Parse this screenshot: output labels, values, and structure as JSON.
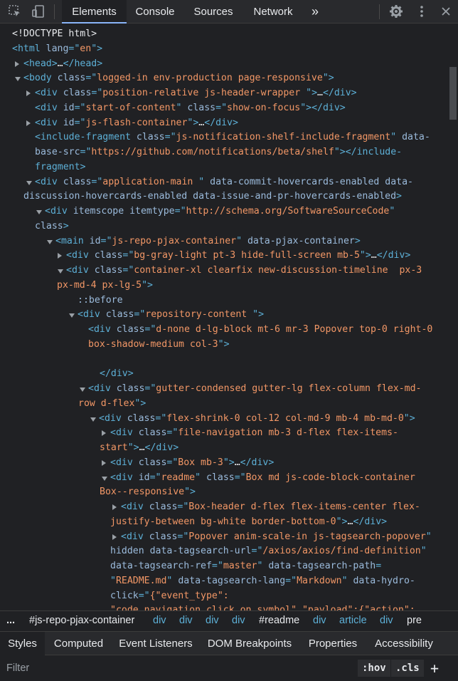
{
  "toolbar": {
    "tabs": [
      "Elements",
      "Console",
      "Sources",
      "Network"
    ],
    "more_tabs": "»",
    "icons": [
      "inspect-element-icon",
      "device-toolbar-icon",
      "settings-gear-icon",
      "more-vertical-icon",
      "close-icon"
    ]
  },
  "tree": [
    {
      "indent": 17,
      "arrow": "",
      "parts": [
        [
          "tx",
          "<!DOCTYPE html>"
        ]
      ]
    },
    {
      "indent": 17,
      "arrow": "",
      "parts": [
        [
          "tg",
          "<html "
        ],
        [
          "an",
          "lang"
        ],
        [
          "tg",
          "=\""
        ],
        [
          "av",
          "en"
        ],
        [
          "tg",
          "\">"
        ]
      ]
    },
    {
      "indent": 33,
      "arrow": "r",
      "parts": [
        [
          "tg",
          "<head>"
        ],
        [
          "tx",
          "…"
        ],
        [
          "tg",
          "</head>"
        ]
      ]
    },
    {
      "indent": 33,
      "arrow": "d",
      "parts": [
        [
          "tg",
          "<body "
        ],
        [
          "an",
          "class"
        ],
        [
          "tg",
          "=\""
        ],
        [
          "av",
          "logged-in env-production page-responsive"
        ],
        [
          "tg",
          "\">"
        ]
      ]
    },
    {
      "indent": 49,
      "arrow": "r",
      "parts": [
        [
          "tg",
          "<div "
        ],
        [
          "an",
          "class"
        ],
        [
          "tg",
          "=\""
        ],
        [
          "av",
          "position-relative js-header-wrapper "
        ],
        [
          "tg",
          "\">"
        ],
        [
          "tx",
          "…"
        ],
        [
          "tg",
          "</div>"
        ]
      ]
    },
    {
      "indent": 49,
      "arrow": "",
      "parts": [
        [
          "tg",
          "<div "
        ],
        [
          "an",
          "id"
        ],
        [
          "tg",
          "=\""
        ],
        [
          "av",
          "start-of-content"
        ],
        [
          "tg",
          "\" "
        ],
        [
          "an",
          "class"
        ],
        [
          "tg",
          "=\""
        ],
        [
          "av",
          "show-on-focus"
        ],
        [
          "tg",
          "\"></div>"
        ]
      ]
    },
    {
      "indent": 49,
      "arrow": "r",
      "parts": [
        [
          "tg",
          "<div "
        ],
        [
          "an",
          "id"
        ],
        [
          "tg",
          "=\""
        ],
        [
          "av",
          "js-flash-container"
        ],
        [
          "tg",
          "\">"
        ],
        [
          "tx",
          "…"
        ],
        [
          "tg",
          "</div>"
        ]
      ]
    },
    {
      "indent": 49,
      "arrow": "",
      "parts": [
        [
          "tg",
          "<include-fragment "
        ],
        [
          "an",
          "class"
        ],
        [
          "tg",
          "=\""
        ],
        [
          "av",
          "js-notification-shelf-include-fragment"
        ],
        [
          "tg",
          "\" "
        ],
        [
          "an",
          "data-"
        ]
      ]
    },
    {
      "indent": 49,
      "arrow": "",
      "parts": [
        [
          "an",
          "base-src"
        ],
        [
          "tg",
          "=\""
        ],
        [
          "av",
          "https://github.com/notifications/beta/shelf"
        ],
        [
          "tg",
          "\"></include-"
        ]
      ]
    },
    {
      "indent": 49,
      "arrow": "",
      "parts": [
        [
          "tg",
          "fragment>"
        ]
      ]
    },
    {
      "indent": 49,
      "arrow": "d",
      "parts": [
        [
          "tg",
          "<div "
        ],
        [
          "an",
          "class"
        ],
        [
          "tg",
          "=\""
        ],
        [
          "av",
          "application-main "
        ],
        [
          "tg",
          "\" "
        ],
        [
          "an",
          "data-commit-hovercards-enabled data-"
        ]
      ]
    },
    {
      "indent": 33,
      "arrow": "",
      "parts": [
        [
          "an",
          "discussion-hovercards-enabled data-issue-and-pr-hovercards-enabled"
        ],
        [
          "tg",
          ">"
        ]
      ]
    },
    {
      "indent": 63,
      "arrow": "d",
      "parts": [
        [
          "tg",
          "<div "
        ],
        [
          "an",
          "itemscope itemtype"
        ],
        [
          "tg",
          "=\""
        ],
        [
          "av",
          "http://schema.org/SoftwareSourceCode"
        ],
        [
          "tg",
          "\""
        ]
      ]
    },
    {
      "indent": 49,
      "arrow": "",
      "parts": [
        [
          "an",
          "class"
        ],
        [
          "tg",
          ">"
        ]
      ]
    },
    {
      "indent": 78,
      "arrow": "d",
      "parts": [
        [
          "tg",
          "<main "
        ],
        [
          "an",
          "id"
        ],
        [
          "tg",
          "=\""
        ],
        [
          "av",
          "js-repo-pjax-container"
        ],
        [
          "tg",
          "\" "
        ],
        [
          "an",
          "data-pjax-container"
        ],
        [
          "tg",
          ">"
        ]
      ]
    },
    {
      "indent": 93,
      "arrow": "r",
      "parts": [
        [
          "tg",
          "<div "
        ],
        [
          "an",
          "class"
        ],
        [
          "tg",
          "=\""
        ],
        [
          "av",
          "bg-gray-light pt-3 hide-full-screen mb-5"
        ],
        [
          "tg",
          "\">"
        ],
        [
          "tx",
          "…"
        ],
        [
          "tg",
          "</div>"
        ]
      ]
    },
    {
      "indent": 93,
      "arrow": "d",
      "parts": [
        [
          "tg",
          "<div "
        ],
        [
          "an",
          "class"
        ],
        [
          "tg",
          "=\""
        ],
        [
          "av",
          "container-xl clearfix new-discussion-timeline  px-3"
        ]
      ]
    },
    {
      "indent": 80,
      "arrow": "",
      "parts": [
        [
          "av",
          "px-md-4 px-lg-5"
        ],
        [
          "tg",
          "\">"
        ]
      ]
    },
    {
      "indent": 109,
      "arrow": "",
      "parts": [
        [
          "ps",
          "::before"
        ]
      ]
    },
    {
      "indent": 109,
      "arrow": "d",
      "parts": [
        [
          "tg",
          "<div "
        ],
        [
          "an",
          "class"
        ],
        [
          "tg",
          "=\""
        ],
        [
          "av",
          "repository-content "
        ],
        [
          "tg",
          "\">"
        ]
      ]
    },
    {
      "indent": 124,
      "arrow": "",
      "parts": [
        [
          "tg",
          "<div "
        ],
        [
          "an",
          "class"
        ],
        [
          "tg",
          "=\""
        ],
        [
          "av",
          "d-none d-lg-block mt-6 mr-3 Popover top-0 right-0"
        ]
      ]
    },
    {
      "indent": 124,
      "arrow": "",
      "parts": [
        [
          "av",
          "box-shadow-medium col-3"
        ],
        [
          "tg",
          "\">"
        ]
      ]
    },
    {
      "indent": 124,
      "arrow": "",
      "parts": [
        [
          "tx",
          " "
        ]
      ]
    },
    {
      "indent": 140,
      "arrow": "",
      "parts": [
        [
          "tg",
          "</div>"
        ]
      ]
    },
    {
      "indent": 124,
      "arrow": "d",
      "parts": [
        [
          "tg",
          "<div "
        ],
        [
          "an",
          "class"
        ],
        [
          "tg",
          "=\""
        ],
        [
          "av",
          "gutter-condensed gutter-lg flex-column flex-md-"
        ]
      ]
    },
    {
      "indent": 110,
      "arrow": "",
      "parts": [
        [
          "av",
          "row d-flex"
        ],
        [
          "tg",
          "\">"
        ]
      ]
    },
    {
      "indent": 139,
      "arrow": "d",
      "parts": [
        [
          "tg",
          "<div "
        ],
        [
          "an",
          "class"
        ],
        [
          "tg",
          "=\""
        ],
        [
          "av",
          "flex-shrink-0 col-12 col-md-9 mb-4 mb-md-0"
        ],
        [
          "tg",
          "\">"
        ]
      ]
    },
    {
      "indent": 155,
      "arrow": "r",
      "parts": [
        [
          "tg",
          "<div "
        ],
        [
          "an",
          "class"
        ],
        [
          "tg",
          "=\""
        ],
        [
          "av",
          "file-navigation mb-3 d-flex flex-items-"
        ]
      ]
    },
    {
      "indent": 140,
      "arrow": "",
      "parts": [
        [
          "av",
          "start"
        ],
        [
          "tg",
          "\">"
        ],
        [
          "tx",
          "…"
        ],
        [
          "tg",
          "</div>"
        ]
      ]
    },
    {
      "indent": 155,
      "arrow": "r",
      "parts": [
        [
          "tg",
          "<div "
        ],
        [
          "an",
          "class"
        ],
        [
          "tg",
          "=\""
        ],
        [
          "av",
          "Box mb-3"
        ],
        [
          "tg",
          "\">"
        ],
        [
          "tx",
          "…"
        ],
        [
          "tg",
          "</div>"
        ]
      ]
    },
    {
      "indent": 155,
      "arrow": "d",
      "parts": [
        [
          "tg",
          "<div "
        ],
        [
          "an",
          "id"
        ],
        [
          "tg",
          "=\""
        ],
        [
          "av",
          "readme"
        ],
        [
          "tg",
          "\" "
        ],
        [
          "an",
          "class"
        ],
        [
          "tg",
          "=\""
        ],
        [
          "av",
          "Box md js-code-block-container"
        ]
      ]
    },
    {
      "indent": 140,
      "arrow": "",
      "parts": [
        [
          "av",
          "Box--responsive"
        ],
        [
          "tg",
          "\">"
        ]
      ]
    },
    {
      "indent": 170,
      "arrow": "r",
      "parts": [
        [
          "tg",
          "<div "
        ],
        [
          "an",
          "class"
        ],
        [
          "tg",
          "=\""
        ],
        [
          "av",
          "Box-header d-flex flex-items-center flex-"
        ]
      ]
    },
    {
      "indent": 155,
      "arrow": "",
      "parts": [
        [
          "av",
          "justify-between bg-white border-bottom-0"
        ],
        [
          "tg",
          "\">"
        ],
        [
          "tx",
          "…"
        ],
        [
          "tg",
          "</div>"
        ]
      ]
    },
    {
      "indent": 170,
      "arrow": "r",
      "parts": [
        [
          "tg",
          "<div "
        ],
        [
          "an",
          "class"
        ],
        [
          "tg",
          "=\""
        ],
        [
          "av",
          "Popover anim-scale-in js-tagsearch-popover"
        ],
        [
          "tg",
          "\""
        ]
      ]
    },
    {
      "indent": 155,
      "arrow": "",
      "parts": [
        [
          "an",
          "hidden data-tagsearch-url"
        ],
        [
          "tg",
          "=\""
        ],
        [
          "av",
          "/axios/axios/find-definition"
        ],
        [
          "tg",
          "\""
        ]
      ]
    },
    {
      "indent": 155,
      "arrow": "",
      "parts": [
        [
          "an",
          "data-tagsearch-ref"
        ],
        [
          "tg",
          "=\""
        ],
        [
          "av",
          "master"
        ],
        [
          "tg",
          "\" "
        ],
        [
          "an",
          "data-tagsearch-path"
        ],
        [
          "tg",
          "="
        ]
      ]
    },
    {
      "indent": 155,
      "arrow": "",
      "parts": [
        [
          "tg",
          "\""
        ],
        [
          "av",
          "README.md"
        ],
        [
          "tg",
          "\" "
        ],
        [
          "an",
          "data-tagsearch-lang"
        ],
        [
          "tg",
          "=\""
        ],
        [
          "av",
          "Markdown"
        ],
        [
          "tg",
          "\" "
        ],
        [
          "an",
          "data-hydro-"
        ]
      ]
    },
    {
      "indent": 155,
      "arrow": "",
      "parts": [
        [
          "an",
          "click"
        ],
        [
          "tg",
          "=\""
        ],
        [
          "av",
          "{\"event_type\":"
        ]
      ]
    },
    {
      "indent": 155,
      "arrow": "",
      "parts": [
        [
          "av",
          "\"code_navigation.click_on_symbol\",\"payload\":{\"action\":"
        ]
      ]
    }
  ],
  "breadcrumbs": {
    "more": "...",
    "items": [
      "#js-repo-pjax-container",
      "div",
      "div",
      "div",
      "div",
      "#readme",
      "div",
      "article",
      "div",
      "pre"
    ]
  },
  "subtabs": [
    "Styles",
    "Computed",
    "Event Listeners",
    "DOM Breakpoints",
    "Properties",
    "Accessibility"
  ],
  "filter": {
    "placeholder": "Filter",
    "hov": ":hov",
    "cls": ".cls",
    "add": "+"
  }
}
